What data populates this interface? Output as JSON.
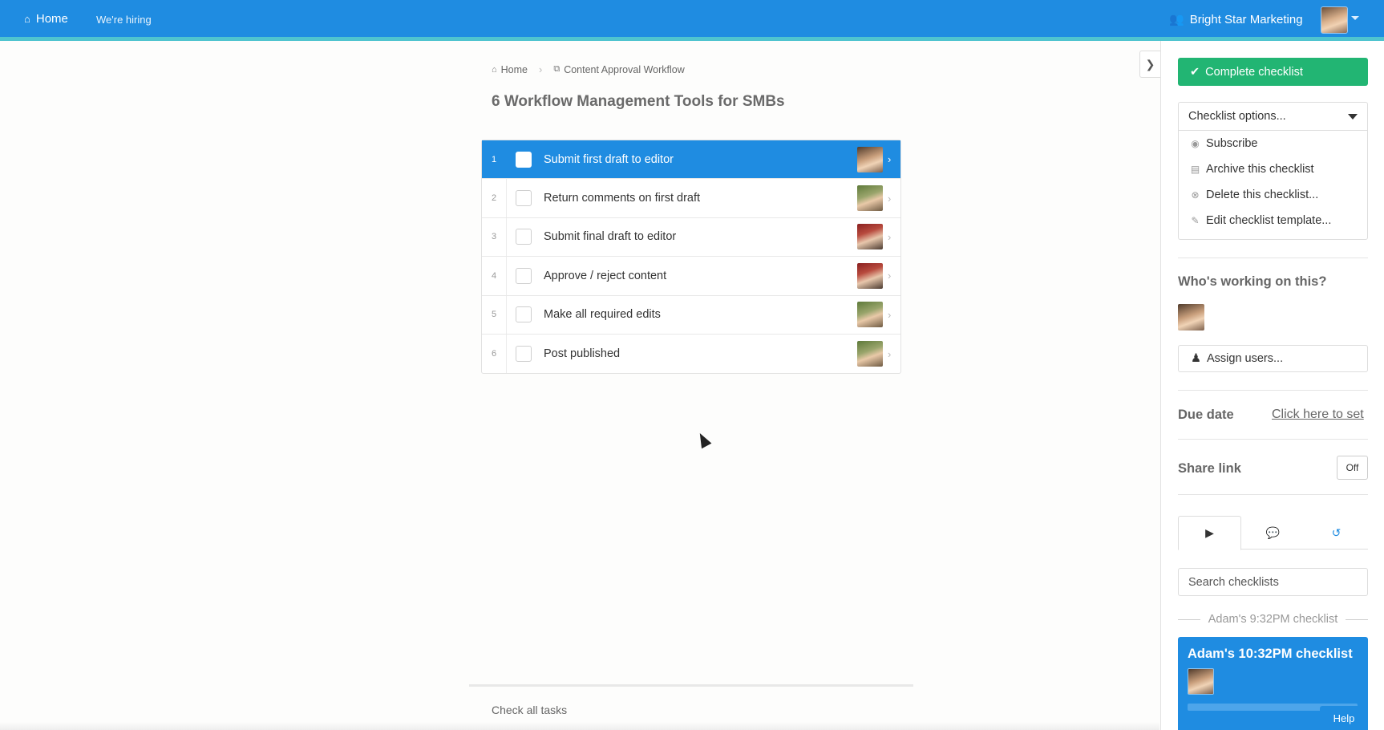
{
  "nav": {
    "home_label": "Home",
    "hiring_label": "We're hiring",
    "org_label": "Bright Star Marketing"
  },
  "breadcrumb": {
    "home": "Home",
    "template": "Content Approval Workflow"
  },
  "page_title": "6 Workflow Management Tools for SMBs",
  "tasks": [
    {
      "num": "1",
      "label": "Submit first draft to editor",
      "active": true
    },
    {
      "num": "2",
      "label": "Return comments on first draft",
      "active": false
    },
    {
      "num": "3",
      "label": "Submit final draft to editor",
      "active": false
    },
    {
      "num": "4",
      "label": "Approve / reject content",
      "active": false
    },
    {
      "num": "5",
      "label": "Make all required edits",
      "active": false
    },
    {
      "num": "6",
      "label": "Post published",
      "active": false
    }
  ],
  "footer": {
    "check_all": "Check all tasks"
  },
  "sidebar": {
    "complete_button": "Complete checklist",
    "options_label": "Checklist options...",
    "options": [
      {
        "icon": "eye-icon",
        "label": "Subscribe"
      },
      {
        "icon": "archive-icon",
        "label": "Archive this checklist"
      },
      {
        "icon": "delete-circle-icon",
        "label": "Delete this checklist..."
      },
      {
        "icon": "pencil-icon",
        "label": "Edit checklist template..."
      }
    ],
    "working_title": "Who's working on this?",
    "assign_label": "Assign users...",
    "due_title": "Due date",
    "due_link": "Click here to set",
    "share_title": "Share link",
    "share_state": "Off",
    "search_placeholder": "Search checklists",
    "group_label": "Adam's 9:32PM checklist",
    "card_title": "Adam's 10:32PM checklist",
    "card_progress": 0.0,
    "help_label": "Help"
  },
  "colors": {
    "brand_blue": "#1f8ce1",
    "complete_green": "#22b573",
    "nav_accent": "#4fc4cf"
  }
}
